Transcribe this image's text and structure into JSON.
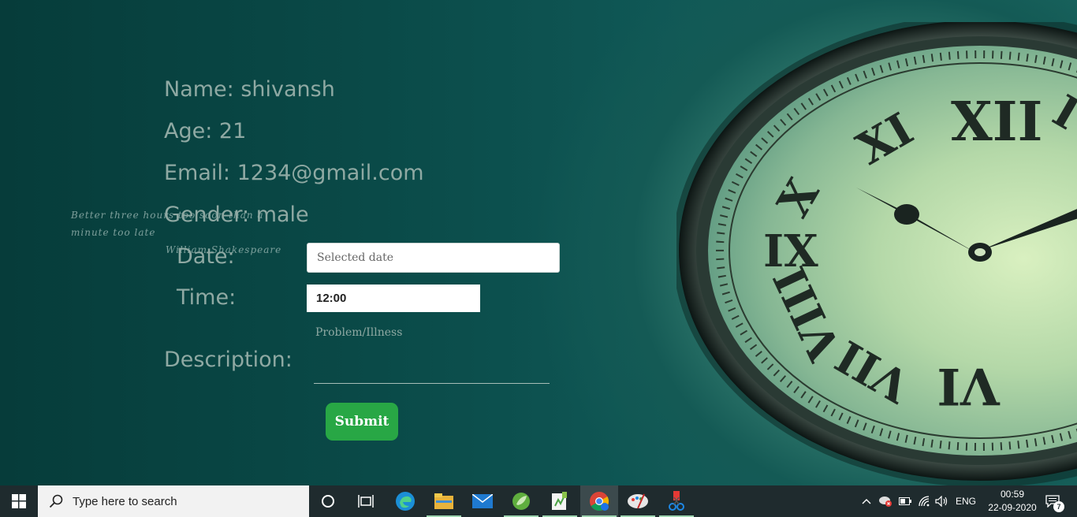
{
  "profile": {
    "name_line": "Name: shivansh",
    "age_line": "Age: 21",
    "email_line": "Email: 1234@gmail.com",
    "gender_line": "Gender: male"
  },
  "form": {
    "date_label": "Date:",
    "date_placeholder": "Selected date",
    "time_label": "Time:",
    "time_value": "12:00",
    "description_label": "Description:",
    "description_placeholder": "Problem/Illness",
    "submit_label": "Submit"
  },
  "taskbar": {
    "search_placeholder": "Type here to search",
    "language": "ENG",
    "time": "00:59",
    "date": "22-09-2020",
    "notification_count": "7",
    "pinned_apps": [
      "cortana-icon",
      "task-view-icon",
      "edge-icon",
      "file-explorer-icon",
      "mail-icon",
      "spring-tool-icon",
      "notepad-plus-icon",
      "chrome-icon",
      "paint-icon",
      "snipping-tool-icon"
    ]
  },
  "colors": {
    "submit": "#28a745",
    "label_text": "#8fa9a3",
    "taskbar": "#1f2b2e"
  }
}
